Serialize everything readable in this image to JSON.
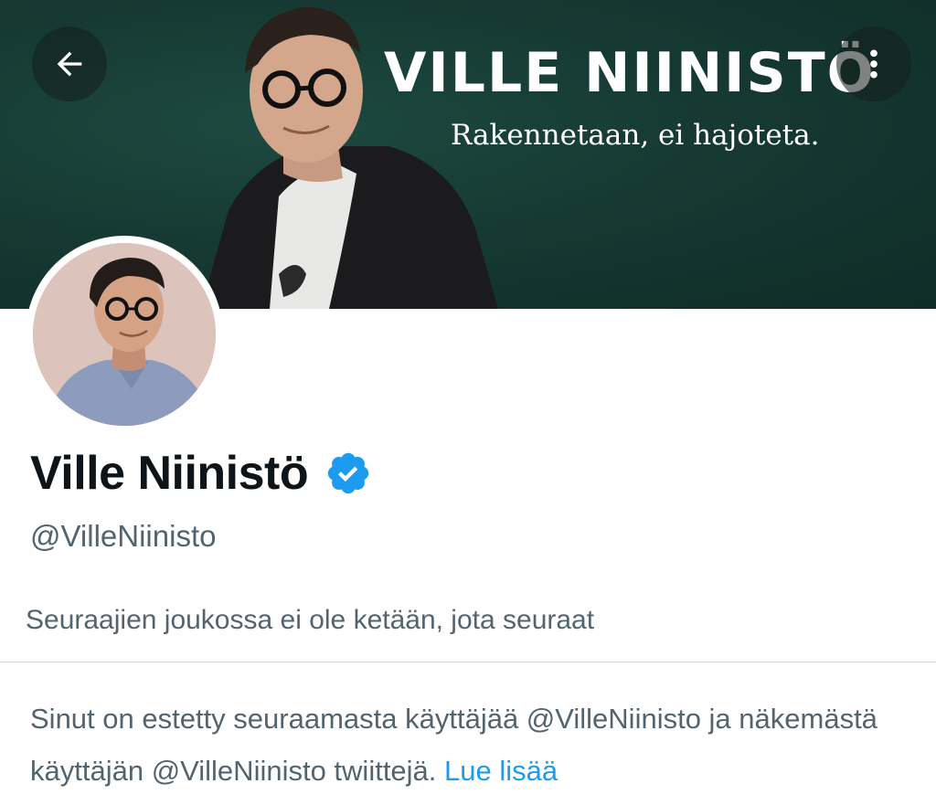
{
  "banner": {
    "title": "VILLE NIINISTÖ",
    "subtitle": "Rakennetaan, ei hajoteta."
  },
  "toolbar": {
    "back_icon": "arrow-left-icon",
    "more_icon": "more-options-icon"
  },
  "profile": {
    "display_name": "Ville Niinistö",
    "verified_icon": "verified-badge-icon",
    "handle": "@VilleNiinisto",
    "followers_note": "Seuraajien joukossa ei ole ketään, jota seuraat"
  },
  "blocked": {
    "message": "Sinut on estetty seuraamasta käyttäjää @VilleNiinisto ja näkemästä käyttäjän @VilleNiinisto twiittejä.",
    "learn_more": "Lue lisää"
  },
  "colors": {
    "accent": "#1d9bf0",
    "banner_bg": "#163a33",
    "secondary_text": "#536471",
    "primary_text": "#0f1419"
  }
}
